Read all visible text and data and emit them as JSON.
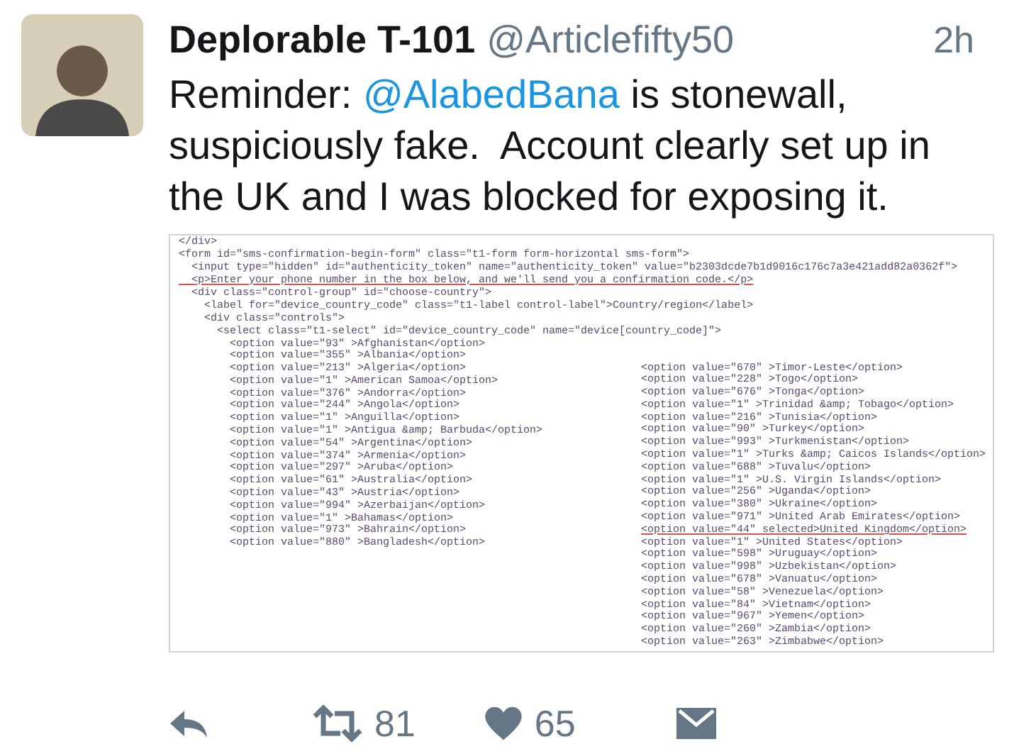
{
  "tweet": {
    "author": {
      "name": "Deplorable T-101",
      "handle": "@Articlefifty50"
    },
    "time": "2h",
    "body": [
      {
        "kind": "text",
        "text": "Reminder: "
      },
      {
        "kind": "mention",
        "text": "@AlabedBana"
      },
      {
        "kind": "text",
        "text": " is stonewall, suspiciously fake.  Account clearly set up in the UK and I was blocked for exposing it."
      }
    ],
    "attachment": {
      "header_lines": [
        {
          "text": "</div>",
          "underlined": false
        },
        {
          "text": "<form id=\"sms-confirmation-begin-form\" class=\"t1-form form-horizontal sms-form\">",
          "underlined": false
        },
        {
          "text": "  <input type=\"hidden\" id=\"authenticity_token\" name=\"authenticity_token\" value=\"b2303dcde7b1d9016c176c7a3e421add82a0362f\">",
          "underlined": false
        },
        {
          "text": "  <p>Enter your phone number in the box below, and we'll send you a confirmation code.</p>",
          "underlined": true
        },
        {
          "text": "  <div class=\"control-group\" id=\"choose-country\">",
          "underlined": false
        },
        {
          "text": "    <label for=\"device_country_code\" class=\"t1-label control-label\">Country/region</label>",
          "underlined": false
        },
        {
          "text": "    <div class=\"controls\">",
          "underlined": false
        },
        {
          "text": "      <select class=\"t1-select\" id=\"device_country_code\" name=\"device[country_code]\">",
          "underlined": false
        }
      ],
      "left_column": [
        {
          "text": "        <option value=\"93\" >Afghanistan</option>",
          "underlined": false
        },
        {
          "text": "        <option value=\"355\" >Albania</option>",
          "underlined": false
        },
        {
          "text": "        <option value=\"213\" >Algeria</option>",
          "underlined": false
        },
        {
          "text": "        <option value=\"1\" >American Samoa</option>",
          "underlined": false
        },
        {
          "text": "        <option value=\"376\" >Andorra</option>",
          "underlined": false
        },
        {
          "text": "        <option value=\"244\" >Angola</option>",
          "underlined": false
        },
        {
          "text": "        <option value=\"1\" >Anguilla</option>",
          "underlined": false
        },
        {
          "text": "        <option value=\"1\" >Antigua &amp; Barbuda</option>",
          "underlined": false
        },
        {
          "text": "        <option value=\"54\" >Argentina</option>",
          "underlined": false
        },
        {
          "text": "        <option value=\"374\" >Armenia</option>",
          "underlined": false
        },
        {
          "text": "        <option value=\"297\" >Aruba</option>",
          "underlined": false
        },
        {
          "text": "        <option value=\"61\" >Australia</option>",
          "underlined": false
        },
        {
          "text": "        <option value=\"43\" >Austria</option>",
          "underlined": false
        },
        {
          "text": "        <option value=\"994\" >Azerbaijan</option>",
          "underlined": false
        },
        {
          "text": "        <option value=\"1\" >Bahamas</option>",
          "underlined": false
        },
        {
          "text": "        <option value=\"973\" >Bahrain</option>",
          "underlined": false
        },
        {
          "text": "        <option value=\"880\" >Bangladesh</option>",
          "underlined": false
        }
      ],
      "right_column": [
        {
          "text": "<option value=\"670\" >Timor-Leste</option>",
          "underlined": false
        },
        {
          "text": "<option value=\"228\" >Togo</option>",
          "underlined": false
        },
        {
          "text": "<option value=\"676\" >Tonga</option>",
          "underlined": false
        },
        {
          "text": "<option value=\"1\" >Trinidad &amp; Tobago</option>",
          "underlined": false
        },
        {
          "text": "<option value=\"216\" >Tunisia</option>",
          "underlined": false
        },
        {
          "text": "<option value=\"90\" >Turkey</option>",
          "underlined": false
        },
        {
          "text": "<option value=\"993\" >Turkmenistan</option>",
          "underlined": false
        },
        {
          "text": "<option value=\"1\" >Turks &amp; Caicos Islands</option>",
          "underlined": false
        },
        {
          "text": "<option value=\"688\" >Tuvalu</option>",
          "underlined": false
        },
        {
          "text": "<option value=\"1\" >U.S. Virgin Islands</option>",
          "underlined": false
        },
        {
          "text": "<option value=\"256\" >Uganda</option>",
          "underlined": false
        },
        {
          "text": "<option value=\"380\" >Ukraine</option>",
          "underlined": false
        },
        {
          "text": "<option value=\"971\" >United Arab Emirates</option>",
          "underlined": false
        },
        {
          "text": "<option value=\"44\" selected>United Kingdom</option>",
          "underlined": true
        },
        {
          "text": "<option value=\"1\" >United States</option>",
          "underlined": false
        },
        {
          "text": "<option value=\"598\" >Uruguay</option>",
          "underlined": false
        },
        {
          "text": "<option value=\"998\" >Uzbekistan</option>",
          "underlined": false
        },
        {
          "text": "<option value=\"678\" >Vanuatu</option>",
          "underlined": false
        },
        {
          "text": "<option value=\"58\" >Venezuela</option>",
          "underlined": false
        },
        {
          "text": "<option value=\"84\" >Vietnam</option>",
          "underlined": false
        },
        {
          "text": "<option value=\"967\" >Yemen</option>",
          "underlined": false
        },
        {
          "text": "<option value=\"260\" >Zambia</option>",
          "underlined": false
        },
        {
          "text": "<option value=\"263\" >Zimbabwe</option>",
          "underlined": false
        }
      ]
    },
    "actions": [
      {
        "kind": "reply"
      },
      {
        "kind": "retweet",
        "count": "81"
      },
      {
        "kind": "like",
        "count": "65"
      },
      {
        "kind": "message"
      }
    ]
  }
}
